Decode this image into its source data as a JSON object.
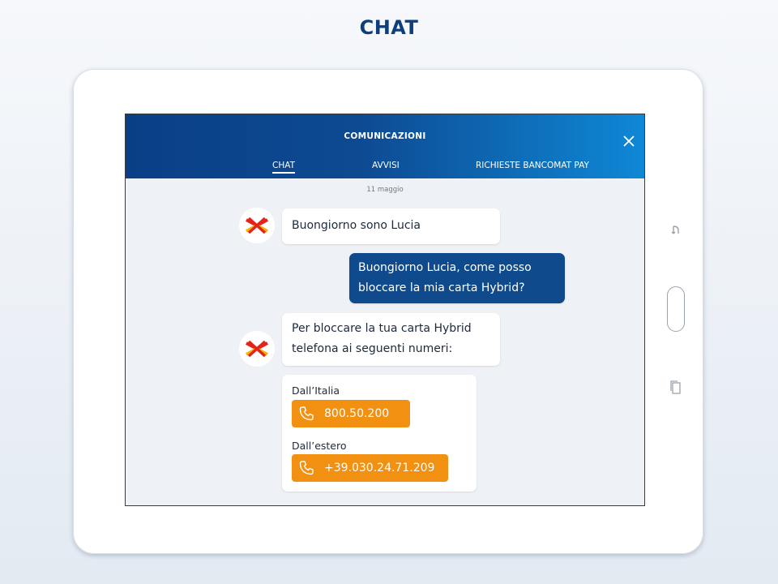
{
  "page_title": "CHAT",
  "app": {
    "header_title": "COMUNICAZIONI",
    "tabs": [
      {
        "label": "CHAT",
        "active": true
      },
      {
        "label": "AVVISI",
        "active": false
      },
      {
        "label": "RICHIESTE BANCOMAT PAY",
        "active": false
      }
    ],
    "close_icon": "close-icon"
  },
  "chat": {
    "date": "11 maggio",
    "messages": [
      {
        "from": "bot",
        "lines": [
          "Buongiorno sono Lucia"
        ]
      },
      {
        "from": "user",
        "lines": [
          "Buongiorno Lucia, come posso",
          "bloccare la mia carta Hybrid?"
        ]
      },
      {
        "from": "bot",
        "lines": [
          "Per bloccare la tua carta Hybrid",
          "telefona ai seguenti numeri:"
        ]
      }
    ],
    "contact_card": {
      "italy_label": "Dall’Italia",
      "italy_number": "800.50.200",
      "abroad_label": "Dall’estero",
      "abroad_number": "+39.030.24.71.209",
      "button_icon": "phone-icon"
    }
  },
  "colors": {
    "accent_blue": "#0f4a8c",
    "button_orange": "#f29012",
    "logo_red": "#e2231a",
    "logo_yellow": "#f7b500"
  }
}
